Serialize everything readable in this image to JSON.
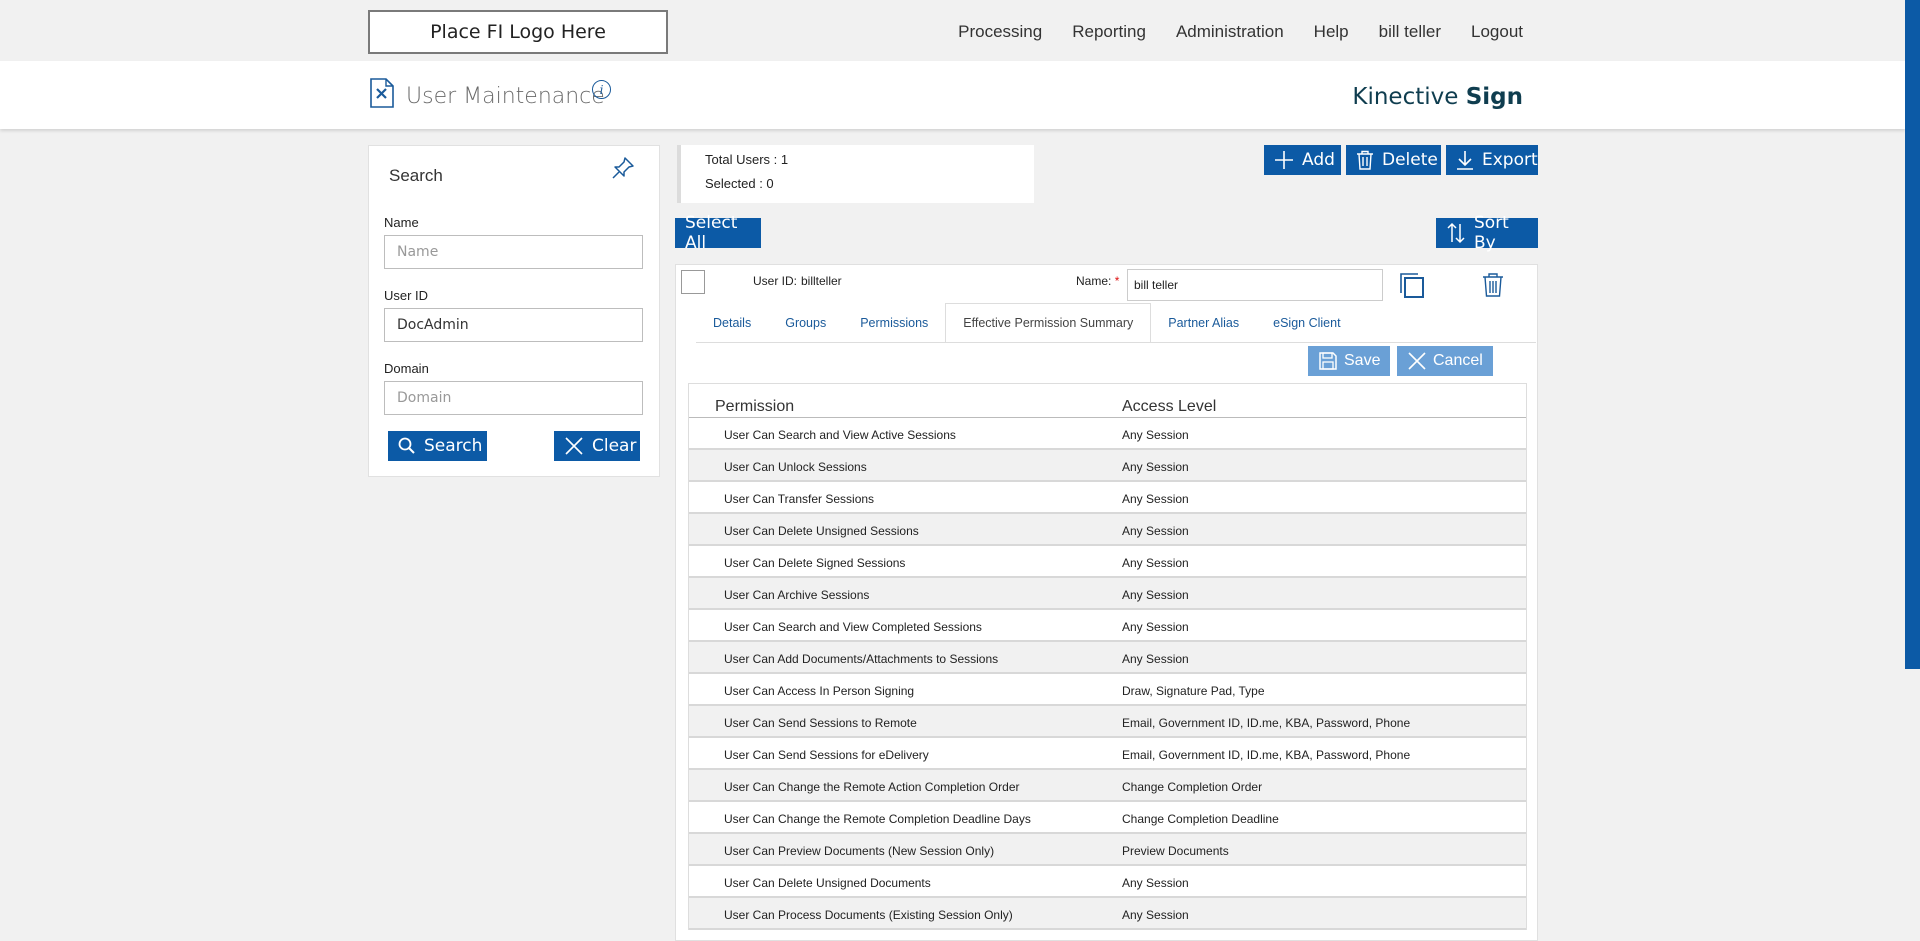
{
  "header": {
    "logo_text": "Place FI Logo Here",
    "nav": [
      "Processing",
      "Reporting",
      "Administration",
      "Help",
      "bill teller",
      "Logout"
    ]
  },
  "subheader": {
    "title": "User Maintenance",
    "info": "i",
    "brand_light": "Kinective ",
    "brand_bold": "Sign"
  },
  "search": {
    "title": "Search",
    "name_label": "Name",
    "name_placeholder": "Name",
    "name_value": "",
    "userid_label": "User ID",
    "userid_value": "DocAdmin",
    "domain_label": "Domain",
    "domain_placeholder": "Domain",
    "search_button": "Search",
    "clear_button": "Clear"
  },
  "counts": {
    "total": "Total Users : 1",
    "selected": "Selected : 0"
  },
  "toolbar": {
    "add": "Add",
    "delete": "Delete",
    "export": "Export",
    "select_all": "Select All",
    "sort_by": "Sort By"
  },
  "user": {
    "userid_label": "User ID:",
    "userid_value": "billteller",
    "name_label": "Name:",
    "required_mark": "*",
    "name_value": "bill teller",
    "tabs": [
      "Details",
      "Groups",
      "Permissions",
      "Effective Permission Summary",
      "Partner Alias",
      "eSign Client"
    ],
    "active_tab": "Effective Permission Summary",
    "save": "Save",
    "cancel": "Cancel"
  },
  "permissions": {
    "headers": [
      "Permission",
      "Access Level"
    ],
    "rows": [
      [
        "User Can Search and View Active Sessions",
        "Any Session"
      ],
      [
        "User Can Unlock Sessions",
        "Any Session"
      ],
      [
        "User Can Transfer Sessions",
        "Any Session"
      ],
      [
        "User Can Delete Unsigned Sessions",
        "Any Session"
      ],
      [
        "User Can Delete Signed Sessions",
        "Any Session"
      ],
      [
        "User Can Archive Sessions",
        "Any Session"
      ],
      [
        "User Can Search and View Completed Sessions",
        "Any Session"
      ],
      [
        "User Can Add Documents/Attachments to Sessions",
        "Any Session"
      ],
      [
        "User Can Access In Person Signing",
        "Draw, Signature Pad, Type"
      ],
      [
        "User Can Send Sessions to Remote",
        "Email, Government ID, ID.me, KBA, Password, Phone"
      ],
      [
        "User Can Send Sessions for eDelivery",
        "Email, Government ID, ID.me, KBA, Password, Phone"
      ],
      [
        "User Can Change the Remote Action Completion Order",
        "Change Completion Order"
      ],
      [
        "User Can Change the Remote Completion Deadline Days",
        "Change Completion Deadline"
      ],
      [
        "User Can Preview Documents (New Session Only)",
        "Preview Documents"
      ],
      [
        "User Can Delete Unsigned Documents",
        "Any Session"
      ],
      [
        "User Can Process Documents (Existing Session Only)",
        "Any Session"
      ]
    ]
  },
  "colors": {
    "primary": "#0c5aa6",
    "disabled_button": "#6aa0d6",
    "brand_text": "#0f3d4f"
  }
}
